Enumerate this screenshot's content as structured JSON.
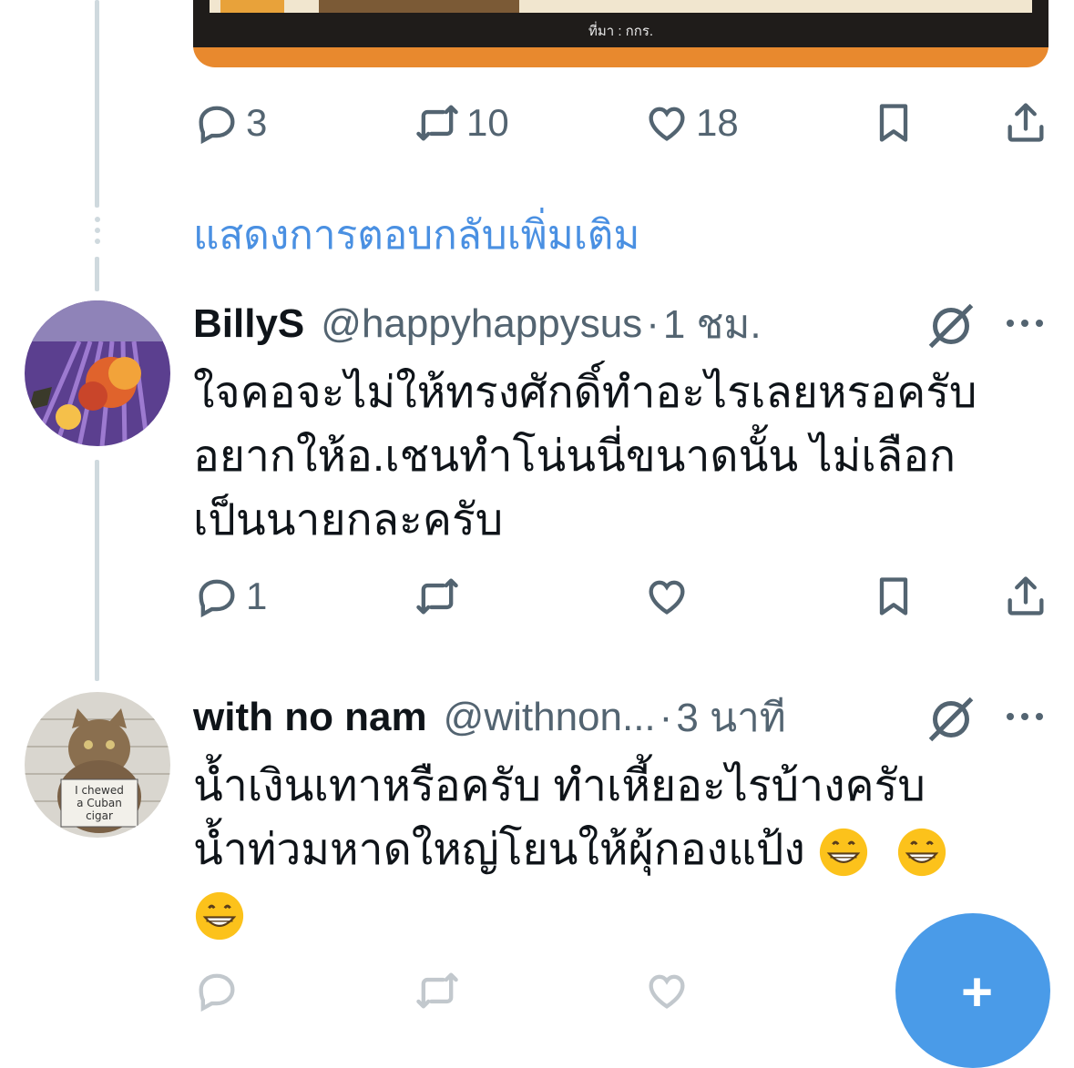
{
  "top_tweet": {
    "media_source": "ที่มา : กกร.",
    "actions": {
      "reply_count": "3",
      "retweet_count": "10",
      "like_count": "18"
    }
  },
  "show_more_replies": "แสดงการตอบกลับเพิ่มเติม",
  "replies": [
    {
      "name": "BillyS",
      "handle": "@happyhappysus",
      "separator": "·",
      "time": "1 ชม.",
      "text_lines": [
        "ใจคอจะไม่ให้ทรงศักดิ์ทำอะไรเลยหรอครับ",
        "อยากให้อ.เชนทำโน่นนี่ขนาดนั้น ไม่เลือก",
        "เป็นนายกละครับ"
      ],
      "actions": {
        "reply_count": "1",
        "retweet_count": "",
        "like_count": ""
      }
    },
    {
      "name": "with no nam",
      "handle": "@withnon...",
      "separator": "·",
      "time": "3 นาที",
      "text_lines": [
        "น้ำเงินเทาหรือครับ ทำเหี้ยอะไรบ้างครับ",
        "น้ำท่วมหาดใหญ่โยนให้ผุ้กองแป้ง"
      ],
      "avatar_sign": [
        "I chewed",
        "a Cuban",
        "cigar"
      ]
    }
  ],
  "icons": {
    "reply": "reply-icon",
    "retweet": "retweet-icon",
    "like": "like-icon",
    "bookmark": "bookmark-icon",
    "share": "share-icon",
    "grok": "grok-icon",
    "more": "more-icon",
    "compose": "compose-plus-icon",
    "emoji": "grinning-emoji-icon"
  },
  "colors": {
    "link_blue": "#4a90e2",
    "muted": "#536471",
    "fab": "#4a9be8",
    "media_accent": "#e8892e"
  }
}
